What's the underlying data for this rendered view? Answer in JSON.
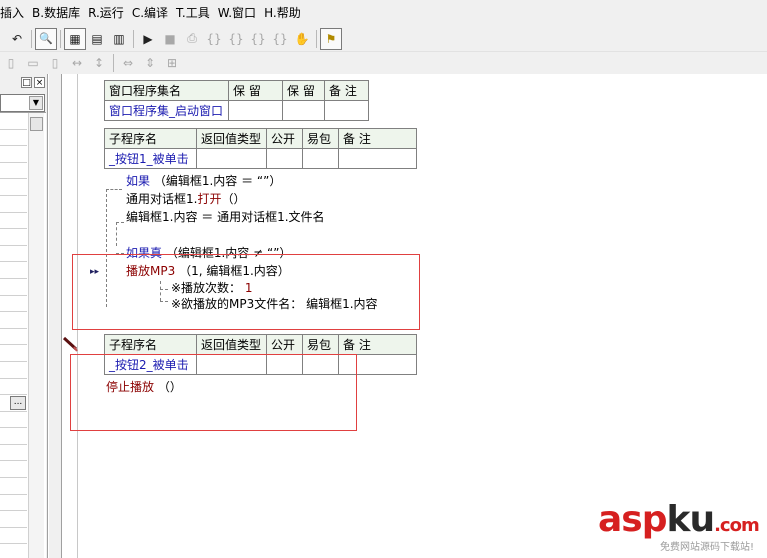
{
  "menu": [
    "插入",
    "B.数据库",
    "R.运行",
    "C.编译",
    "T.工具",
    "W.窗口",
    "H.帮助"
  ],
  "toolbar1": [
    {
      "icon": "undo-icon",
      "glyph": "↶"
    },
    {
      "icon": "find-icon",
      "glyph": "🔍"
    },
    {
      "icon": "layout1-icon",
      "glyph": "▦"
    },
    {
      "icon": "layout2-icon",
      "glyph": "▤"
    },
    {
      "icon": "layout3-icon",
      "glyph": "▥"
    },
    {
      "icon": "run-icon",
      "glyph": "▶"
    },
    {
      "icon": "stop-icon",
      "glyph": "■"
    },
    {
      "icon": "step-icon",
      "glyph": "⎙"
    },
    {
      "icon": "step-into-icon",
      "glyph": "{}"
    },
    {
      "icon": "step-over-icon",
      "glyph": "{}"
    },
    {
      "icon": "step-out-icon",
      "glyph": "{}"
    },
    {
      "icon": "run-to-cursor-icon",
      "glyph": "{}"
    },
    {
      "icon": "hand-icon",
      "glyph": "✋"
    },
    {
      "icon": "inspect-icon",
      "glyph": "⚑"
    }
  ],
  "window_controls": {
    "restore": "□",
    "close": "×"
  },
  "panel": {
    "ellipsis": "..."
  },
  "table1": {
    "headers": [
      "窗口程序集名",
      "保 留",
      "保 留",
      "备 注"
    ],
    "row": [
      "窗口程序集_启动窗口",
      "",
      "",
      ""
    ]
  },
  "table2": {
    "headers": [
      "子程序名",
      "返回值类型",
      "公开",
      "易包",
      "备 注"
    ],
    "row": [
      "_按钮1_被单击",
      "",
      "",
      "",
      ""
    ]
  },
  "table3": {
    "headers": [
      "子程序名",
      "返回值类型",
      "公开",
      "易包",
      "备 注"
    ],
    "row": [
      "_按钮2_被单击",
      "",
      "",
      "",
      ""
    ]
  },
  "code": {
    "line1_kw": "如果",
    "line1_rest": "（编辑框1.内容 ＝ “”）",
    "line2_a": "通用对话框1.",
    "line2_b": "打开",
    "line2_c": "（）",
    "line3": "编辑框1.内容 ＝ 通用对话框1.文件名",
    "line4_kw": "如果真",
    "line4_rest": "（编辑框1.内容 ≠ “”）",
    "line5_kw": "播放MP3",
    "line5_rest": "（1, 编辑框1.内容）",
    "line6_label": "※播放次数：",
    "line6_val": "1",
    "line7": "※欲播放的MP3文件名： 编辑框1.内容",
    "line8_kw": "停止播放",
    "line8_rest": "（）",
    "arrow": "▸▸"
  },
  "watermark": {
    "asp": "asp",
    "ku": "ku",
    "com": ".com",
    "sub": "免费网站源码下载站!"
  }
}
